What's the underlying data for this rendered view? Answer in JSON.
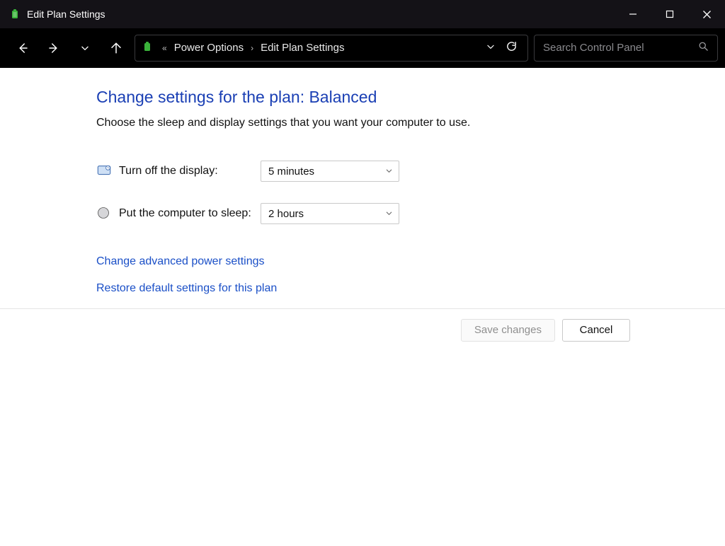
{
  "window": {
    "title": "Edit Plan Settings"
  },
  "breadcrumb": {
    "parent": "Power Options",
    "current": "Edit Plan Settings"
  },
  "search": {
    "placeholder": "Search Control Panel"
  },
  "page": {
    "heading": "Change settings for the plan: Balanced",
    "subheading": "Choose the sleep and display settings that you want your computer to use."
  },
  "settings": {
    "display_off": {
      "label": "Turn off the display:",
      "value": "5 minutes"
    },
    "sleep": {
      "label": "Put the computer to sleep:",
      "value": "2 hours"
    }
  },
  "links": {
    "advanced": "Change advanced power settings",
    "restore": "Restore default settings for this plan"
  },
  "buttons": {
    "save": "Save changes",
    "cancel": "Cancel"
  }
}
